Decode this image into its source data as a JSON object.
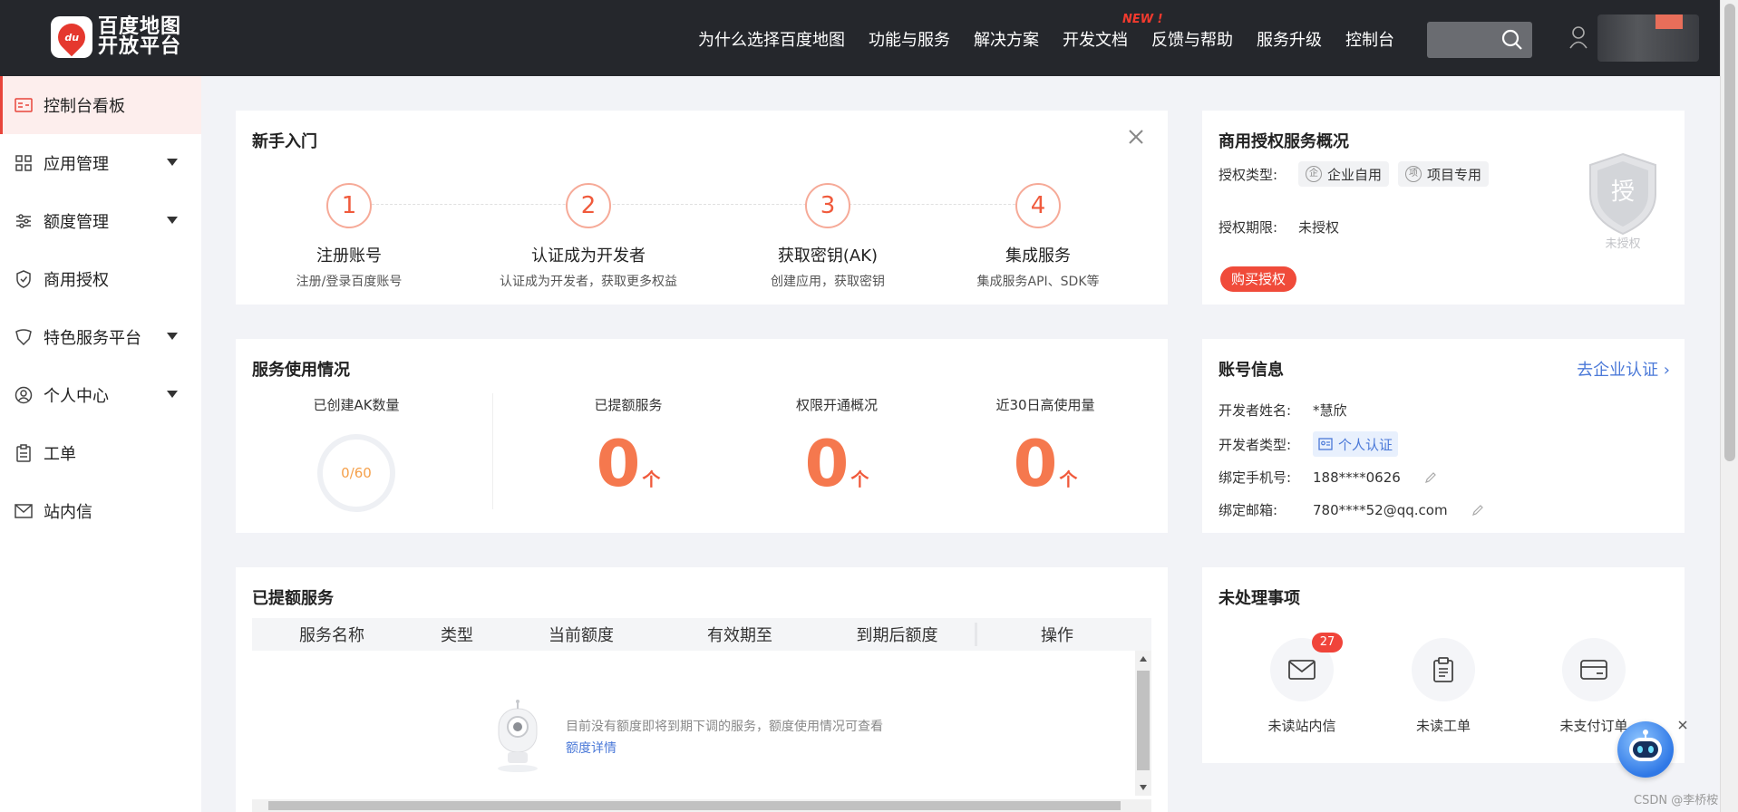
{
  "header": {
    "logo_text_line1": "百度地图",
    "logo_text_line2": "开放平台",
    "logo_mark": "du",
    "nav": [
      "为什么选择百度地图",
      "功能与服务",
      "解决方案",
      "开发文档",
      "反馈与帮助",
      "服务升级",
      "控制台"
    ],
    "new_tag": "NEW !"
  },
  "sidebar": {
    "items": [
      {
        "label": "控制台看板",
        "icon": "dashboard-icon"
      },
      {
        "label": "应用管理",
        "icon": "grid-icon"
      },
      {
        "label": "额度管理",
        "icon": "sliders-icon"
      },
      {
        "label": "商用授权",
        "icon": "shield-check-icon"
      },
      {
        "label": "特色服务平台",
        "icon": "tag-icon"
      },
      {
        "label": "个人中心",
        "icon": "user-circle-icon"
      },
      {
        "label": "工单",
        "icon": "clipboard-icon"
      },
      {
        "label": "站内信",
        "icon": "mail-icon"
      }
    ]
  },
  "onboarding": {
    "title": "新手入门",
    "steps": [
      {
        "num": "1",
        "title": "注册账号",
        "desc": "注册/登录百度账号"
      },
      {
        "num": "2",
        "title": "认证成为开发者",
        "desc": "认证成为开发者，获取更多权益"
      },
      {
        "num": "3",
        "title": "获取密钥(AK)",
        "desc": "创建应用，获取密钥"
      },
      {
        "num": "4",
        "title": "集成服务",
        "desc": "集成服务API、SDK等"
      }
    ]
  },
  "license": {
    "title": "商用授权服务概况",
    "type_label": "授权类型:",
    "type_options": [
      {
        "icon": "企",
        "label": "企业自用"
      },
      {
        "icon": "项",
        "label": "项目专用"
      }
    ],
    "period_label": "授权期限:",
    "period_value": "未授权",
    "buy_button": "购买授权",
    "seal_char": "授",
    "seal_caption": "未授权"
  },
  "usage": {
    "title": "服务使用情况",
    "ak_label": "已创建AK数量",
    "ak_value": "0/60",
    "columns": [
      {
        "label": "已提额服务",
        "value": "0",
        "unit": "个"
      },
      {
        "label": "权限开通概况",
        "value": "0",
        "unit": "个"
      },
      {
        "label": "近30日高使用量",
        "value": "0",
        "unit": "个"
      }
    ]
  },
  "account": {
    "title": "账号信息",
    "verify_link": "去企业认证",
    "rows": [
      {
        "label": "开发者姓名:",
        "value": "*慧欣"
      },
      {
        "label": "开发者类型:",
        "value": "个人认证"
      },
      {
        "label": "绑定手机号:",
        "value": "188****0626"
      },
      {
        "label": "绑定邮箱:",
        "value": "780****52@qq.com"
      }
    ]
  },
  "raised": {
    "title": "已提额服务",
    "columns": [
      "服务名称",
      "类型",
      "当前额度",
      "有效期至",
      "到期后额度",
      "操作"
    ],
    "empty_text": "目前没有额度即将到期下调的服务，额度使用情况可查看",
    "empty_link": "额度详情"
  },
  "todo": {
    "title": "未处理事项",
    "items": [
      {
        "label": "未读站内信",
        "badge": "27",
        "icon": "mail-icon"
      },
      {
        "label": "未读工单",
        "icon": "clipboard-icon"
      },
      {
        "label": "未支付订单",
        "icon": "card-icon"
      }
    ]
  },
  "watermark": "CSDN @李桥桉",
  "colors": {
    "accent": "#f04b3a",
    "orange": "#f5784e",
    "link": "#4b79d8",
    "nav_bg": "#25272c"
  }
}
